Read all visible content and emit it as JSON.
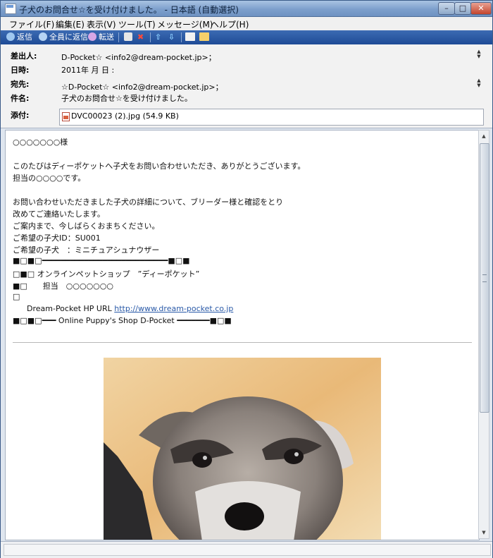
{
  "window": {
    "title": "子犬のお問合せ☆を受け付けました。 - 日本語 (自動選択)"
  },
  "menu": [
    "ファイル(F)",
    "編集(E)",
    "表示(V)",
    "ツール(T)",
    "メッセージ(M)",
    "ヘルプ(H)"
  ],
  "toolbar": {
    "reply": "返信",
    "reply_all": "全員に返信",
    "forward": "転送"
  },
  "header": {
    "from_label": "差出人:",
    "from_value": "D-Pocket☆ <info2@dream-pocket.jp>；",
    "date_label": "日時:",
    "date_value": "2011年  月    日    :",
    "to_label": "宛先:",
    "to_value": "☆D-Pocket☆ <info2@dream-pocket.jp>；",
    "subject_label": "件名:",
    "subject_value": "子犬のお問合せ☆を受け付けました。",
    "attach_label": "添付:",
    "attach_value": "DVC00023 (2).jpg (54.9 KB)"
  },
  "body": {
    "greeting": "○○○○○○○様",
    "p1": "このたびはディーポケットへ子犬をお問い合わせいただき、ありがとうございます。",
    "p2": "担当の○○○○です。",
    "p3": "お問い合わせいただきました子犬の詳細について、ブリーダー様と確認をとり",
    "p4": "改めてご連絡いたします。",
    "p5": "ご案内まで、今しばらくおまちください。",
    "p6": "ご希望の子犬ID：SU001",
    "p7": "ご希望の子犬　：ミニチュアシュナウザー",
    "sig1": "■□■□━━━━━━━━━━━━━━━━━━━━━━━━━━━■□■",
    "sig2": "□■□ オンラインペットショップ　”ディーポケット”",
    "sig3": "■□　　担当　○○○○○○○",
    "sig4": "□",
    "sig5_prefix": "Dream-Pocket HP URL ",
    "sig5_link": "http://www.dream-pocket.co.jp",
    "sig6": "■□■□━━━  Online Puppy's Shop D-Pocket  ━━━━━━━■□■"
  }
}
